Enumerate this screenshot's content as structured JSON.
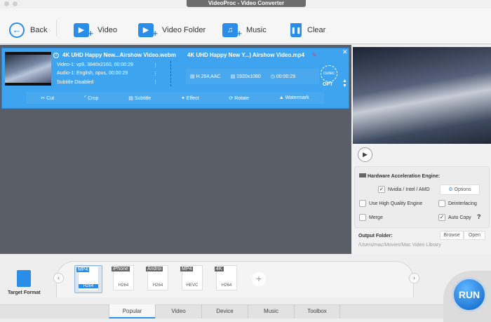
{
  "window": {
    "title": "VideoProc - Video Converter"
  },
  "toolbar": {
    "back": "Back",
    "video": "Video",
    "video_folder": "Video Folder",
    "music": "Music",
    "clear": "Clear"
  },
  "item": {
    "source_name": "4K UHD Happy New...Airshow Video.webm",
    "video_track": "Video-1: vp9, 3840x2160, 00:00:29",
    "audio_track": "Audio-1: English, opus, 00:00:29",
    "subtitle": "Subtitle Disabled",
    "output_name": "4K UHD Happy New Y...) Airshow Video.mp4",
    "codec": "H.264,AAC",
    "resolution": "1920x1080",
    "duration": "00:00:29",
    "codec_badge": "codec",
    "opt": "OPT",
    "edits": [
      "Cut",
      "Crop",
      "Subtitle",
      "Effect",
      "Rotate",
      "Watermark"
    ]
  },
  "settings": {
    "hw_title": "Hardware Acceleration Engine:",
    "nvidia": "Nvidia / Intel / AMD",
    "nvidia_checked": true,
    "options": "Options",
    "hq": "Use High Quality Engine",
    "hq_checked": false,
    "deinterlacing": "Deinterlacing",
    "deinterlacing_checked": false,
    "merge": "Merge",
    "merge_checked": false,
    "autocopy": "Auto Copy",
    "autocopy_checked": true,
    "help": "?",
    "output_label": "Output Folder:",
    "browse": "Browse",
    "open": "Open",
    "output_path": "/Users/mac/Movies/Mac Video Library"
  },
  "bottom": {
    "target_format": "Target Format",
    "formats": [
      {
        "tag": "MP4",
        "codec": "H264"
      },
      {
        "tag": "iPhone",
        "codec": "H264"
      },
      {
        "tag": "Androi",
        "codec": "H264"
      },
      {
        "tag": "MP4",
        "codec": "HEVC"
      },
      {
        "tag": "4K",
        "codec": "H264"
      }
    ],
    "tabs": [
      "Popular",
      "Video",
      "Device",
      "Music",
      "Toolbox"
    ],
    "run": "RUN"
  },
  "colors": {
    "accent": "#2a8de8",
    "card": "#3ea4ef"
  }
}
